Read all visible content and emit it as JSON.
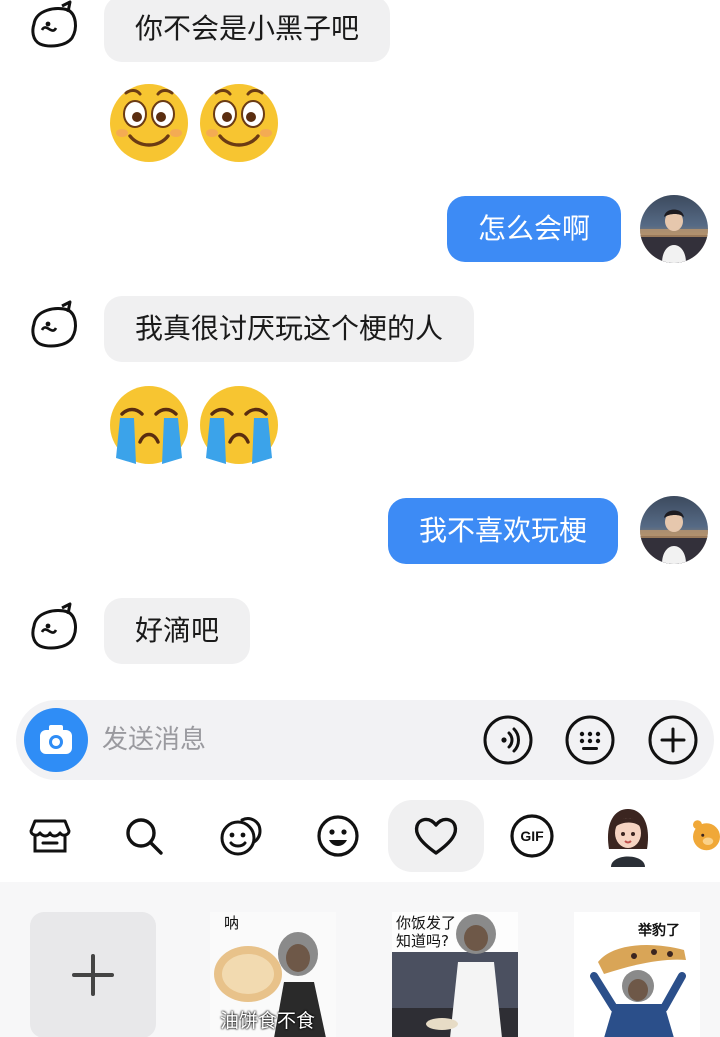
{
  "messages": [
    {
      "side": "in",
      "type": "text",
      "text": "你不会是小黑子吧"
    },
    {
      "side": "in",
      "type": "emoji",
      "emoji": [
        "smile-face",
        "smile-face"
      ]
    },
    {
      "side": "out",
      "type": "text",
      "text": "怎么会啊"
    },
    {
      "side": "in",
      "type": "text",
      "text": "我真很讨厌玩这个梗的人"
    },
    {
      "side": "in",
      "type": "emoji",
      "emoji": [
        "crying-face",
        "crying-face"
      ]
    },
    {
      "side": "out",
      "type": "text",
      "text": "我不喜欢玩梗"
    },
    {
      "side": "in",
      "type": "text",
      "text": "好滴吧"
    }
  ],
  "input": {
    "placeholder": "发送消息"
  },
  "toolbar": {
    "icons": [
      "store-icon",
      "search-icon",
      "emoji-face-icon",
      "smile-icon",
      "heart-icon",
      "gif-icon",
      "avatar-girl-icon",
      "bear-icon"
    ],
    "active": "heart-icon",
    "gif_label": "GIF"
  },
  "stickers": [
    {
      "top_caption": "呐",
      "bottom_caption": "油饼食不食"
    },
    {
      "top_caption": "你饭发了知道吗?",
      "bottom_caption": ""
    },
    {
      "top_caption": "举豹了",
      "bottom_caption": ""
    }
  ],
  "colors": {
    "accent": "#3d8bf5",
    "camera": "#2f8df6",
    "bubble_in": "#f0f0f1"
  }
}
